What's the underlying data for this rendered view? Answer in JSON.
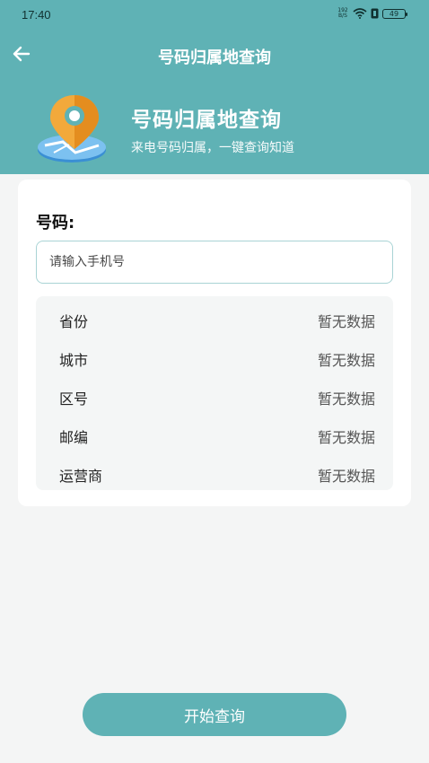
{
  "status_bar": {
    "time": "17:40",
    "net_speed": "192\nB/S",
    "battery": "49"
  },
  "nav": {
    "back_icon": "arrow-left-icon",
    "title": "号码归属地查询"
  },
  "banner": {
    "icon": "location-pin-icon",
    "title": "号码归属地查询",
    "subtitle": "来电号码归属，一键查询知道"
  },
  "form": {
    "label": "号码:",
    "input_value": "",
    "input_placeholder": "请输入手机号"
  },
  "results": [
    {
      "label": "省份",
      "value": "暂无数据"
    },
    {
      "label": "城市",
      "value": "暂无数据"
    },
    {
      "label": "区号",
      "value": "暂无数据"
    },
    {
      "label": "邮编",
      "value": "暂无数据"
    },
    {
      "label": "运营商",
      "value": "暂无数据"
    }
  ],
  "query_button": "开始查询",
  "colors": {
    "primary": "#5fb2b5",
    "background": "#f4f5f5",
    "card": "#ffffff",
    "result_box": "#f4f6f6"
  }
}
